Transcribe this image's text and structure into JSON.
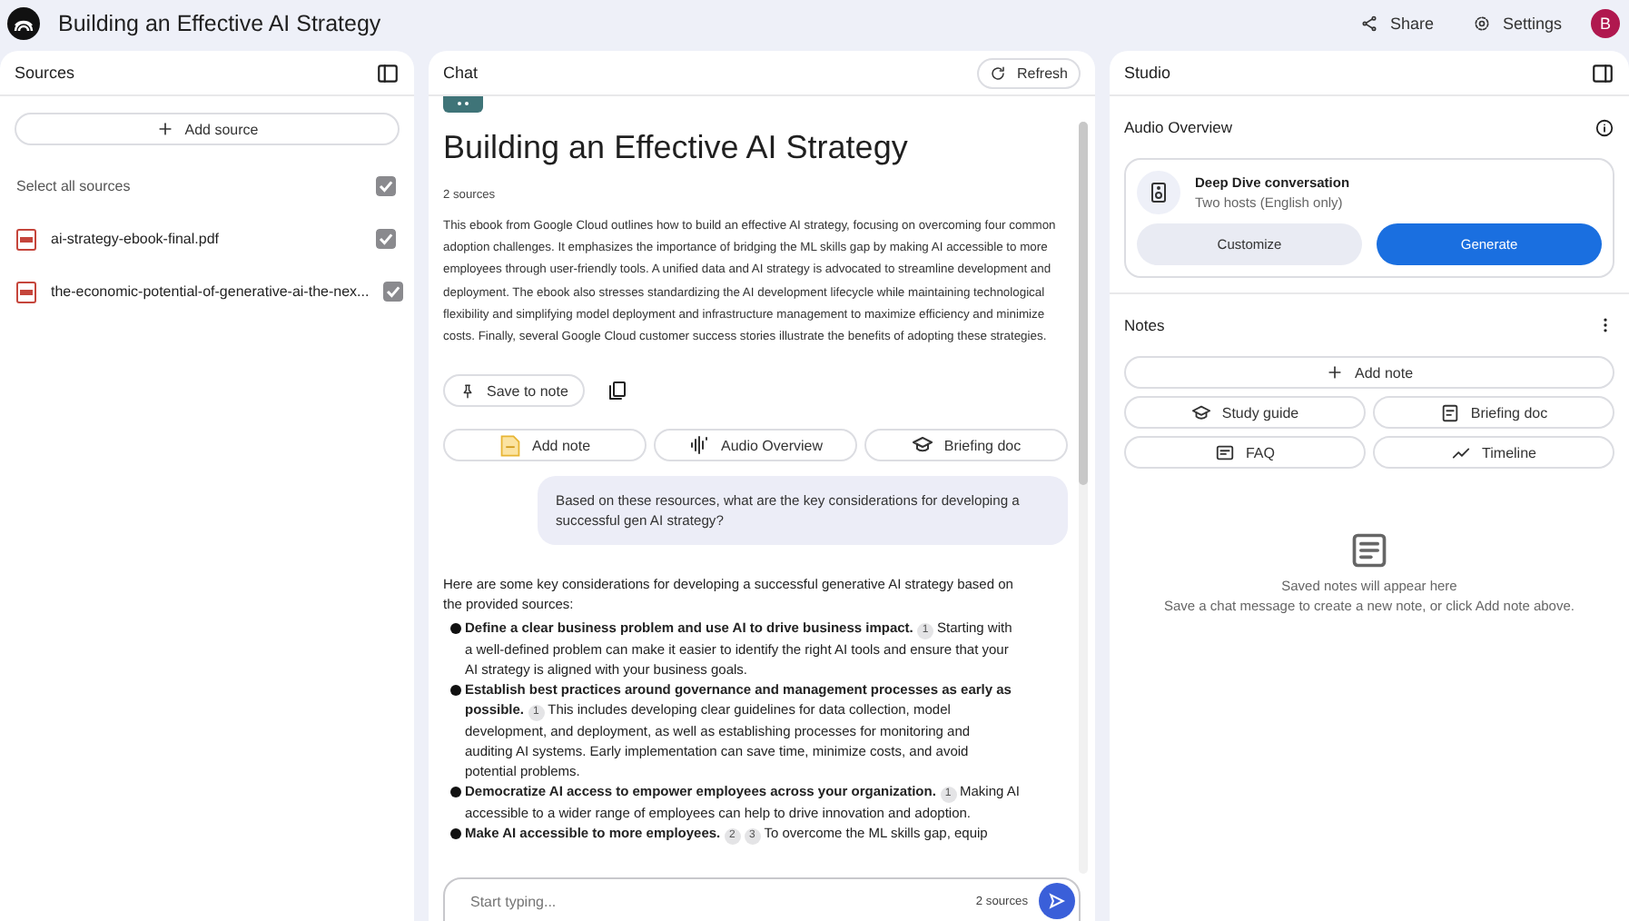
{
  "header": {
    "title": "Building an Effective AI Strategy",
    "share": "Share",
    "settings": "Settings",
    "avatar": "B"
  },
  "sources": {
    "title": "Sources",
    "add_source": "Add source",
    "select_all": {
      "label": "Select all sources",
      "checked": true
    },
    "items": [
      {
        "name": "ai-strategy-ebook-final.pdf",
        "checked": true
      },
      {
        "name": "the-economic-potential-of-generative-ai-the-nex...",
        "checked": true
      }
    ]
  },
  "chat": {
    "title": "Chat",
    "refresh": "Refresh",
    "notebook_title": "Building an Effective AI Strategy",
    "source_count": "2 sources",
    "summary": "This ebook from Google Cloud outlines how to build an effective AI strategy, focusing on overcoming four common adoption challenges. It emphasizes the importance of bridging the ML skills gap by making AI accessible to more employees through user-friendly tools. A unified data and AI strategy is advocated to streamline development and deployment. The ebook also stresses standardizing the AI development lifecycle while maintaining technological flexibility and simplifying model deployment and infrastructure management to maximize efficiency and minimize costs. Finally, several Google Cloud customer success stories illustrate the benefits of adopting these strategies.",
    "save_to_note": "Save to note",
    "actions": [
      {
        "kind": "note",
        "label": "Add note"
      },
      {
        "kind": "audio",
        "label": "Audio Overview"
      },
      {
        "kind": "briefing",
        "label": "Briefing doc"
      }
    ],
    "question": "Based on these resources, what are the key considerations for developing a successful gen AI strategy?",
    "response": {
      "intro": "Here are some key considerations for developing a successful generative AI strategy based on the provided sources:",
      "bullets": [
        {
          "heading": "Define a clear business problem and use AI to drive business impact.",
          "citations": [
            "1"
          ],
          "text": "Starting with a well-defined problem can make it easier to identify the right AI tools and ensure that your AI strategy is aligned with your business goals."
        },
        {
          "heading": "Establish best practices around governance and management processes as early as possible.",
          "citations": [
            "1"
          ],
          "text": "This includes developing clear guidelines for data collection, model development, and deployment, as well as establishing processes for monitoring and auditing AI systems. Early implementation can save time, minimize costs, and avoid potential problems."
        },
        {
          "heading": "Democratize AI access to empower employees across your organization.",
          "citations": [
            "1"
          ],
          "text": "Making AI accessible to a wider range of employees can help to drive innovation and adoption."
        },
        {
          "heading": "Make AI accessible to more employees.",
          "citations": [
            "2",
            "3"
          ],
          "text": "To overcome the ML skills gap, equip"
        }
      ]
    },
    "input": {
      "placeholder": "Start typing...",
      "source_count": "2 sources"
    }
  },
  "studio": {
    "title": "Studio",
    "audio_overview": {
      "title": "Audio Overview",
      "card_title": "Deep Dive conversation",
      "card_subtitle": "Two hosts (English only)",
      "customize": "Customize",
      "generate": "Generate"
    },
    "notes": {
      "title": "Notes",
      "add_note": "Add note",
      "buttons": [
        {
          "kind": "study",
          "label": "Study guide"
        },
        {
          "kind": "briefing",
          "label": "Briefing doc"
        },
        {
          "kind": "faq",
          "label": "FAQ"
        },
        {
          "kind": "timeline",
          "label": "Timeline"
        }
      ],
      "empty_title": "Saved notes will appear here",
      "empty_hint": "Save a chat message to create a new note, or click Add note above."
    }
  }
}
